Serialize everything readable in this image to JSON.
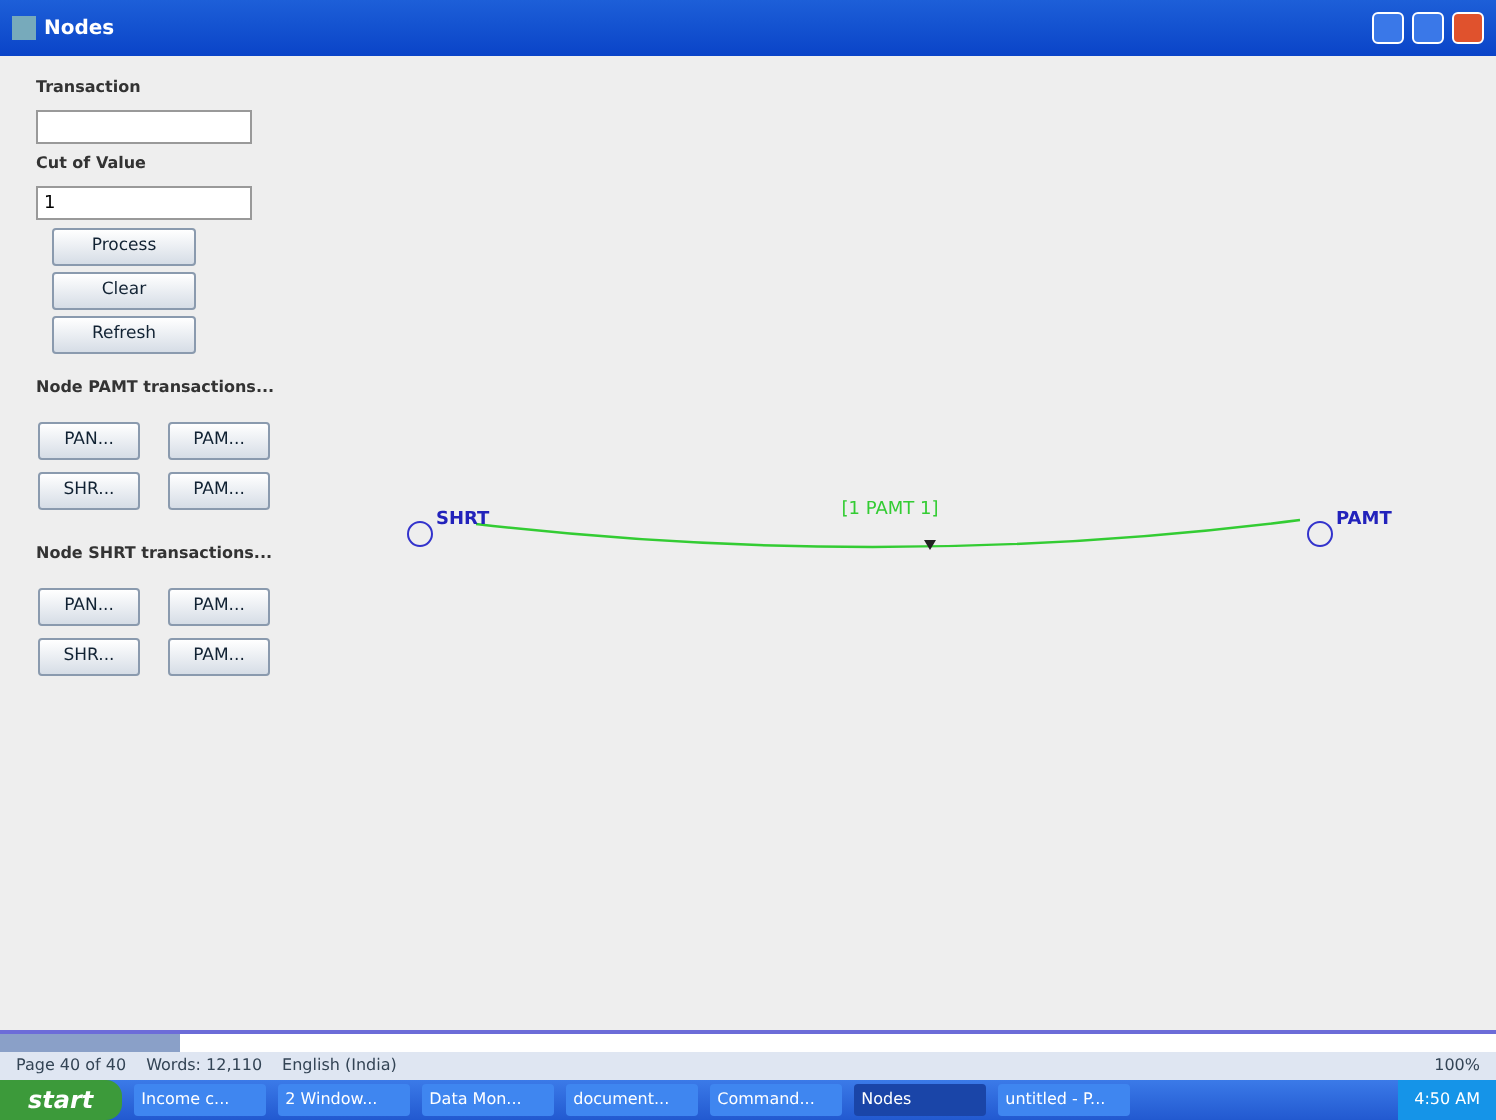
{
  "window": {
    "title": "Nodes"
  },
  "form": {
    "fields": [
      {
        "label": "Transaction"
      },
      {
        "label": "Cut of Value",
        "value": "1"
      }
    ],
    "buttons": [
      "Process",
      "Clear",
      "Refresh"
    ],
    "groups": [
      {
        "label": "Node PAMT transactions...",
        "buttons": [
          "PAN...",
          "PAM...",
          "SHR...",
          "PAM..."
        ]
      },
      {
        "label": "Node SHRT transactions...",
        "buttons": [
          "PAN...",
          "PAM...",
          "SHR...",
          "PAM..."
        ]
      }
    ]
  },
  "graph": {
    "nodes": [
      {
        "label": "SHRT"
      },
      {
        "label": "PAMT"
      }
    ],
    "edges": [
      {
        "label": "[1 PAMT 1]"
      }
    ]
  },
  "status_bar": {
    "items": [
      "Page 40 of 40",
      "Words: 12,110",
      "English (India)"
    ],
    "zoom": "100%"
  },
  "taskbar": {
    "start": "start",
    "items": [
      {
        "label": "Income c...",
        "selected": false
      },
      {
        "label": "2 Window...",
        "selected": false
      },
      {
        "label": "Data Mon...",
        "selected": false
      },
      {
        "label": "document...",
        "selected": false
      },
      {
        "label": "Command...",
        "selected": false
      },
      {
        "label": "Nodes",
        "selected": true
      },
      {
        "label": "untitled - P...",
        "selected": false
      }
    ],
    "clock": "4:50 AM"
  }
}
